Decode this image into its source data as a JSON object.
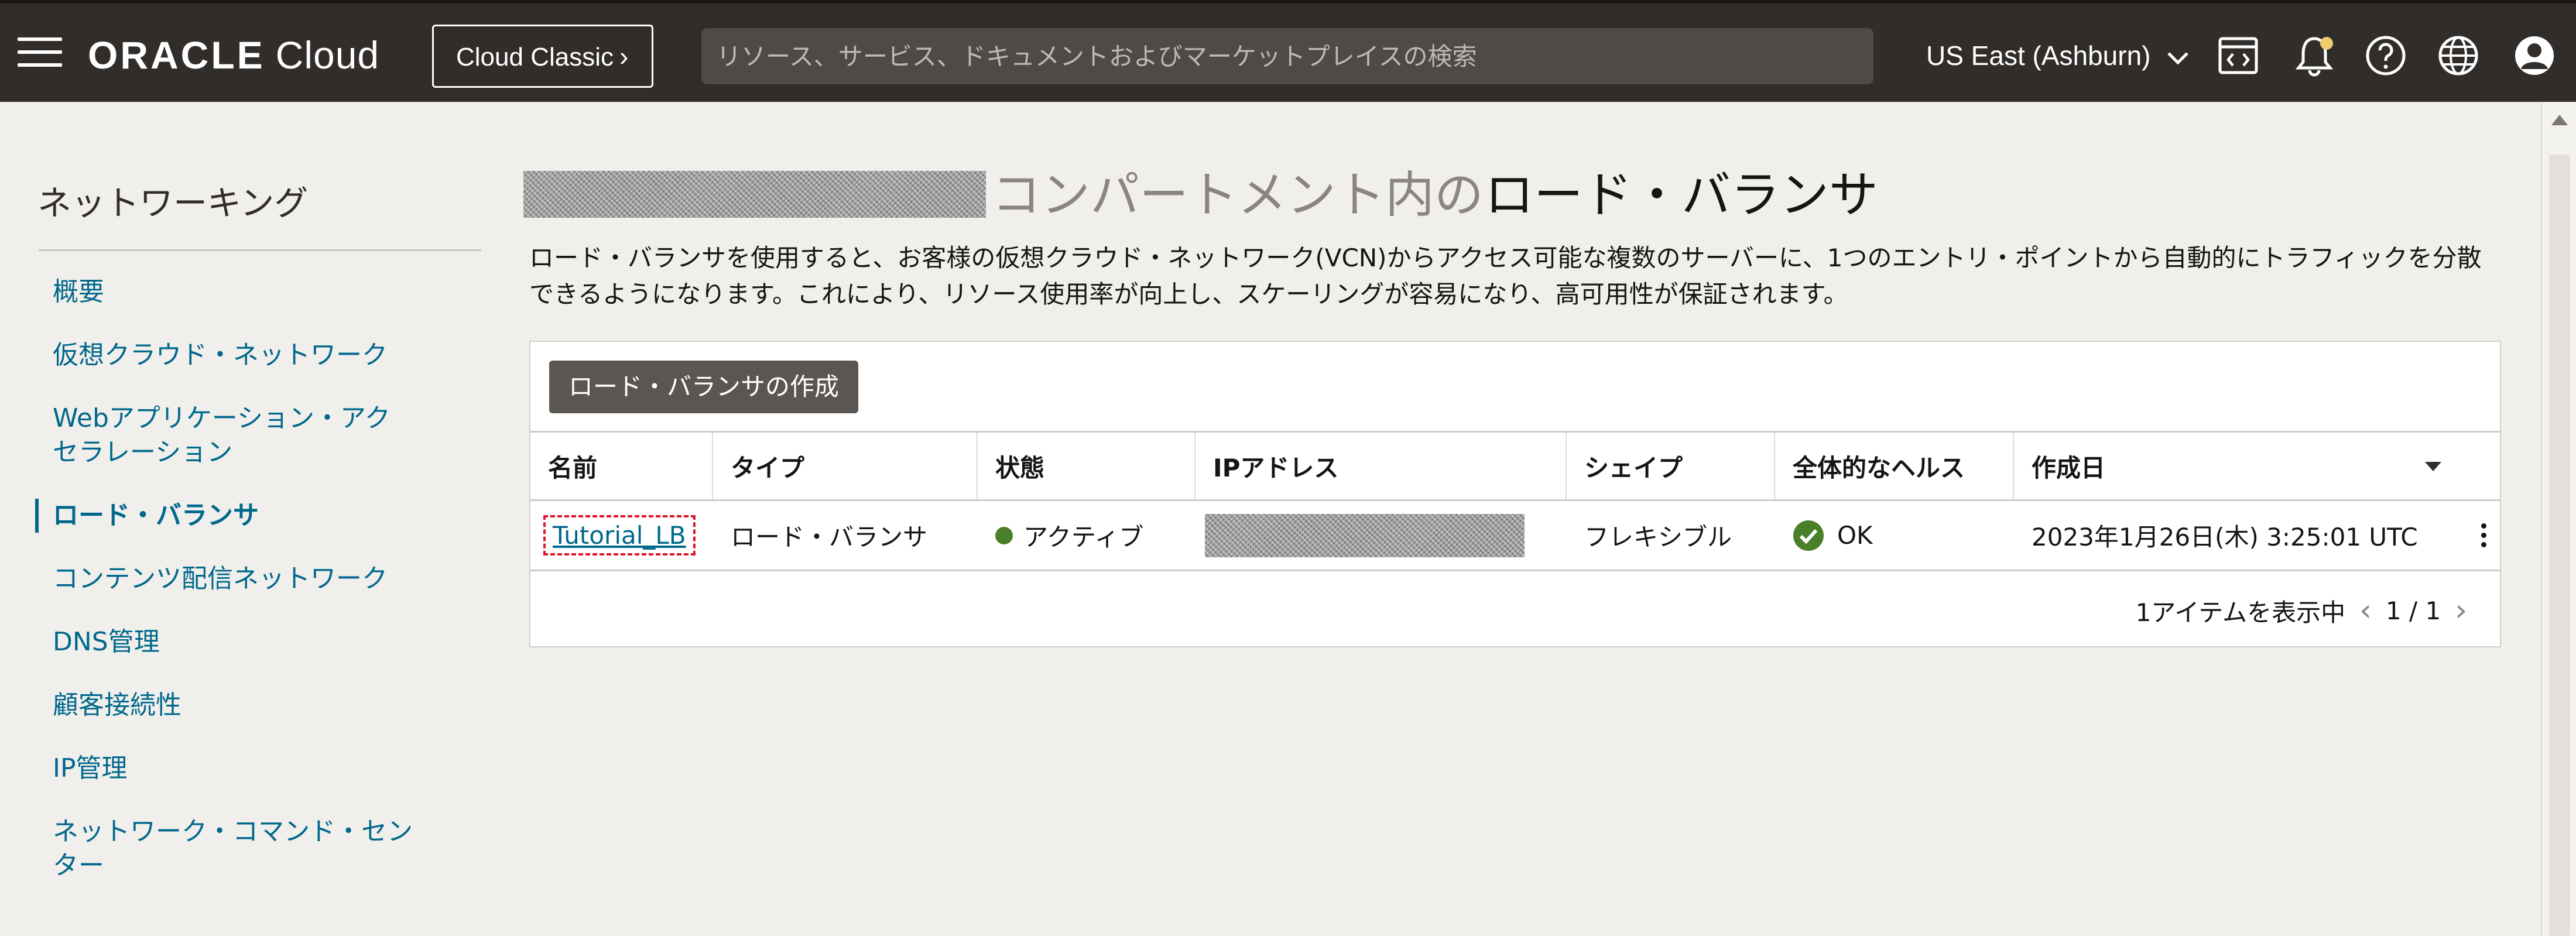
{
  "header": {
    "brand_oracle": "ORACLE",
    "brand_cloud": "Cloud",
    "classic_label": "Cloud Classic",
    "search_placeholder": "リソース、サービス、ドキュメントおよびマーケットプレイスの検索",
    "region": "US East (Ashburn)",
    "icons": [
      "menu-icon",
      "code-editor-icon",
      "bell-icon",
      "help-icon",
      "globe-icon",
      "user-icon"
    ]
  },
  "sidebar": {
    "title": "ネットワーキング",
    "items": [
      {
        "label": "概要"
      },
      {
        "label": "仮想クラウド・ネットワーク"
      },
      {
        "label": "Webアプリケーション・アクセラレーション"
      },
      {
        "label": "ロード・バランサ",
        "active": true
      },
      {
        "label": "コンテンツ配信ネットワーク"
      },
      {
        "label": "DNS管理"
      },
      {
        "label": "顧客接続性"
      },
      {
        "label": "IP管理"
      },
      {
        "label": "ネットワーク・コマンド・センター"
      }
    ]
  },
  "main": {
    "title_prefix": "コンパートメント内の",
    "title_main": "ロード・バランサ",
    "description": "ロード・バランサを使用すると、お客様の仮想クラウド・ネットワーク(VCN)からアクセス可能な複数のサーバーに、1つのエントリ・ポイントから自動的にトラフィックを分散できるようになります。これにより、リソース使用率が向上し、スケーリングが容易になり、高可用性が保証されます。",
    "create_button": "ロード・バランサの作成",
    "table": {
      "columns": [
        "名前",
        "タイプ",
        "状態",
        "IPアドレス",
        "シェイプ",
        "全体的なヘルス",
        "作成日"
      ],
      "rows": [
        {
          "name": "Tutorial_LB",
          "type": "ロード・バランサ",
          "state": "アクティブ",
          "shape": "フレキシブル",
          "health": "OK",
          "created": "2023年1月26日(木) 3:25:01 UTC"
        }
      ]
    },
    "pager": {
      "summary": "1アイテムを表示中",
      "page": "1 / 1"
    }
  },
  "colors": {
    "header_bg": "#312d2a",
    "link": "#00688c",
    "active_dot": "#4a8029",
    "highlight": "#e0152b"
  }
}
